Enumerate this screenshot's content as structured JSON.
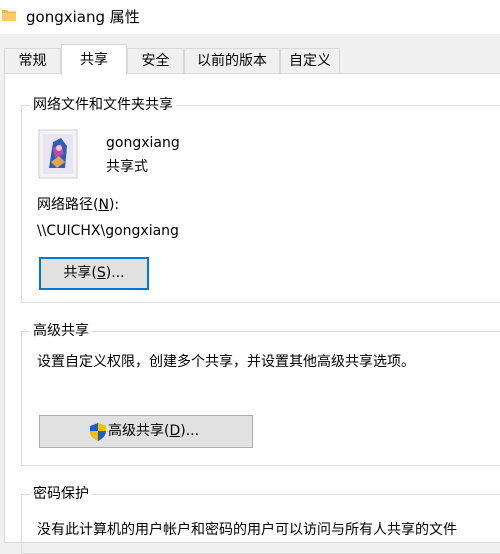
{
  "window": {
    "title": "gongxiang 属性"
  },
  "tabs": [
    {
      "label": "常规",
      "active": false
    },
    {
      "label": "共享",
      "active": true
    },
    {
      "label": "安全",
      "active": false
    },
    {
      "label": "以前的版本",
      "active": false
    },
    {
      "label": "自定义",
      "active": false
    }
  ],
  "network_sharing": {
    "group_title": "网络文件和文件夹共享",
    "folder_name": "gongxiang",
    "share_status": "共享式",
    "path_label": "网络路径",
    "path_label_key": "N",
    "path_label_suffix": ":",
    "path_value": "\\\\CUICHX\\gongxiang",
    "share_button": {
      "prefix": "共享(",
      "key": "S",
      "suffix": ")..."
    }
  },
  "advanced_sharing": {
    "group_title": "高级共享",
    "description": "设置自定义权限，创建多个共享，并设置其他高级共享选项。",
    "button": {
      "prefix": "高级共享(",
      "key": "D",
      "suffix": ")..."
    }
  },
  "password_protection": {
    "group_title": "密码保护",
    "description": "没有此计算机的用户帐户和密码的用户可以访问与所有人共享的文件"
  },
  "colors": {
    "accent": "#0078d7",
    "shield_blue": "#1f5fbf",
    "shield_yellow": "#f2c200"
  }
}
